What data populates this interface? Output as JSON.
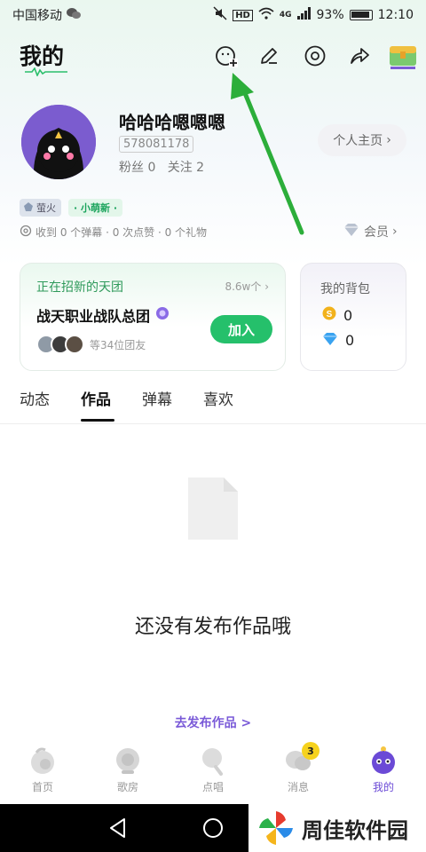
{
  "status_bar": {
    "carrier": "中国移动",
    "network": "4G",
    "battery": "93%",
    "time": "12:10"
  },
  "header": {
    "title": "我的"
  },
  "profile": {
    "username": "哈哈哈嗯嗯嗯",
    "uid": "578081178",
    "fans": "粉丝 0",
    "following": "关注 2",
    "homepage_button": "个人主页",
    "badge_level": "萤火",
    "badge_new": "· 小萌新 ·",
    "stats": "收到 0 个弹幕 · 0 次点赞 · 0 个礼物",
    "vip": "会员"
  },
  "group_card": {
    "heading": "正在招新的天团",
    "count": "8.6w个",
    "name": "战天职业战队总团",
    "members": "等34位团友",
    "join_button": "加入"
  },
  "bag_card": {
    "title": "我的背包",
    "coins": "0",
    "diamonds": "0"
  },
  "tabs": [
    {
      "label": "动态"
    },
    {
      "label": "作品"
    },
    {
      "label": "弹幕"
    },
    {
      "label": "喜欢"
    }
  ],
  "empty_state": {
    "message": "还没有发布作品哦",
    "publish_link": "去发布作品 >"
  },
  "bottom_nav": [
    {
      "label": "首页"
    },
    {
      "label": "歌房"
    },
    {
      "label": "点唱"
    },
    {
      "label": "消息",
      "badge": "3"
    },
    {
      "label": "我的"
    }
  ],
  "watermark": {
    "text": "周佳软件园"
  },
  "colors": {
    "accent_green": "#25c06b",
    "accent_purple": "#6b4ad6",
    "arrow_green": "#2cae3a"
  }
}
